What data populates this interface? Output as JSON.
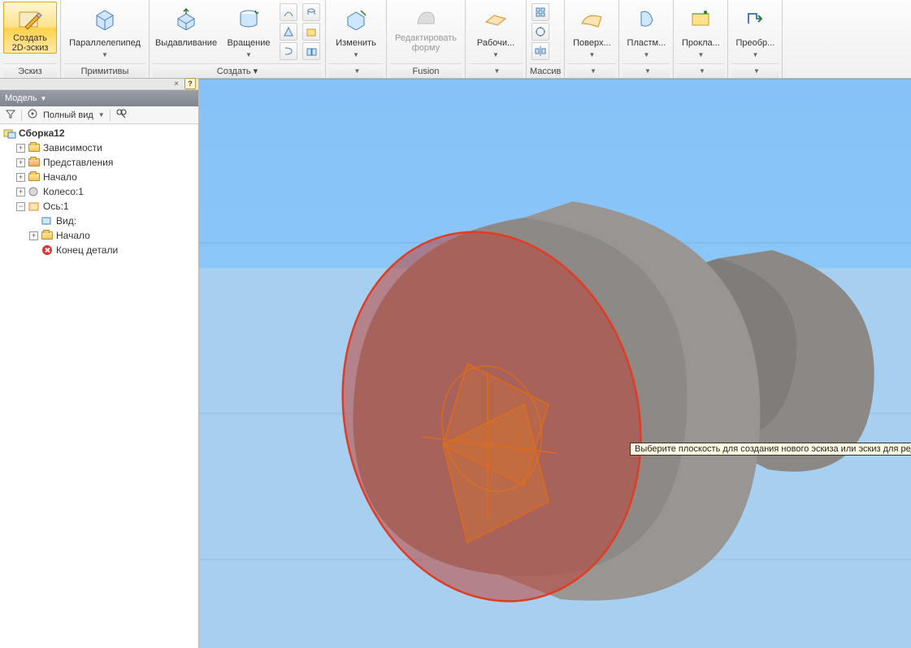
{
  "ribbon": {
    "groups": [
      {
        "id": "sketch",
        "footer": "Эскиз",
        "items": [
          {
            "id": "create2d",
            "label": "Создать\n2D-эскиз",
            "active": true,
            "hasDrop": true
          }
        ]
      },
      {
        "id": "prims",
        "footer": "Примитивы",
        "items": [
          {
            "id": "box",
            "label": "Параллелепипед",
            "hasDrop": true
          }
        ]
      },
      {
        "id": "create",
        "footer": "Создать ▾",
        "items": [
          {
            "id": "extrude",
            "label": "Выдавливание"
          },
          {
            "id": "revolve",
            "label": "Вращение",
            "hasDrop": true
          }
        ],
        "hasMiniCol": true
      },
      {
        "id": "modify",
        "footer": "▾",
        "items": [
          {
            "id": "modify",
            "label": "Изменить",
            "hasDrop": true
          }
        ]
      },
      {
        "id": "fusion",
        "footer": "Fusion",
        "items": [
          {
            "id": "editform",
            "label": "Редактировать\nформу",
            "disabled": true
          }
        ]
      },
      {
        "id": "workfeat",
        "footer": "▾",
        "items": [
          {
            "id": "workpl",
            "label": "Рабочи...",
            "hasDrop": true
          }
        ]
      },
      {
        "id": "pattern",
        "footer": "Массив",
        "hasMiniOnly": true
      },
      {
        "id": "surface",
        "footer": "▾",
        "items": [
          {
            "id": "surf",
            "label": "Поверх...",
            "hasDrop": true
          }
        ]
      },
      {
        "id": "plastic",
        "footer": "▾",
        "items": [
          {
            "id": "plast",
            "label": "Пластм...",
            "hasDrop": true
          }
        ]
      },
      {
        "id": "gasket",
        "footer": "▾",
        "items": [
          {
            "id": "gasket",
            "label": "Прокла...",
            "hasDrop": true
          }
        ]
      },
      {
        "id": "convert",
        "footer": "▾",
        "items": [
          {
            "id": "conv",
            "label": "Преобр...",
            "hasDrop": true
          }
        ]
      }
    ]
  },
  "panel": {
    "title": "Модель",
    "viewMode": "Полный вид",
    "tree": {
      "root": "Сборка12",
      "items": [
        {
          "lvl": 1,
          "tw": "+",
          "ico": "folder",
          "label": "Зависимости"
        },
        {
          "lvl": 1,
          "tw": "+",
          "ico": "folder-o",
          "label": "Представления"
        },
        {
          "lvl": 1,
          "tw": "+",
          "ico": "folder",
          "label": "Начало"
        },
        {
          "lvl": 1,
          "tw": "+",
          "ico": "part",
          "label": "Колесо:1"
        },
        {
          "lvl": 1,
          "tw": "-",
          "ico": "part-o",
          "label": "Ось:1"
        },
        {
          "lvl": 2,
          "tw": "",
          "ico": "view",
          "label": "Вид:"
        },
        {
          "lvl": 2,
          "tw": "+",
          "ico": "folder",
          "label": "Начало"
        },
        {
          "lvl": 2,
          "tw": "",
          "ico": "redx",
          "label": "Конец детали"
        }
      ]
    }
  },
  "viewport": {
    "tooltip": "Выберите плоскость для создания нового эскиза или эскиз для редактирования"
  }
}
